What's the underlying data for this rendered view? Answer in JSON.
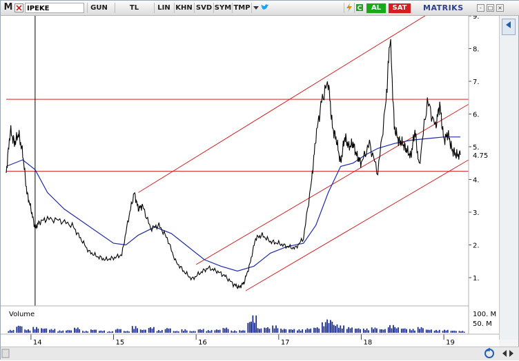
{
  "toolbar": {
    "logo": "M",
    "symbol": "IPEKE",
    "buttons": [
      "GUN",
      "TL",
      "LIN",
      "KHN",
      "SVD",
      "SYM",
      "TMP"
    ],
    "al_label": "AL",
    "sat_label": "SAT",
    "brand": "MATRIKS",
    "window_buttons": [
      "-",
      "□",
      "×"
    ]
  },
  "volume_panel": {
    "label": "Volume",
    "axis_labels": [
      "100. M",
      "50. M"
    ]
  },
  "colors": {
    "price_line": "#000000",
    "moving_average": "#1c2ba8",
    "channel_lines": "#d42020",
    "volume_bars": "#1c2f8e",
    "current_value_marker": "#000000"
  },
  "chart_data": {
    "type": "line",
    "symbol": "IPEKE",
    "current_value": "4.75",
    "y_ticks": [
      "9.",
      "8.",
      "7.",
      "6.",
      "5.",
      "4.",
      "3.",
      "2.",
      "1."
    ],
    "y_range": [
      0.2,
      9.0
    ],
    "x_ticks": [
      "14",
      "15",
      "16",
      "17",
      "18",
      "19"
    ],
    "x_range": [
      13.7,
      19.3
    ],
    "vertical_marker_x": 14.05,
    "horizontal_levels": [
      6.45,
      4.25
    ],
    "channel_lines": [
      {
        "x": [
          15.3,
          18.9
        ],
        "y": [
          3.6,
          9.2
        ]
      },
      {
        "x": [
          16.0,
          19.3
        ],
        "y": [
          1.4,
          6.3
        ]
      },
      {
        "x": [
          16.6,
          19.3
        ],
        "y": [
          0.6,
          4.6
        ]
      }
    ],
    "price_series": {
      "x": [
        13.7,
        13.75,
        13.8,
        13.85,
        13.9,
        13.95,
        14.0,
        14.05,
        14.1,
        14.2,
        14.35,
        14.5,
        14.6,
        14.7,
        14.8,
        14.9,
        15.0,
        15.1,
        15.18,
        15.25,
        15.3,
        15.35,
        15.45,
        15.55,
        15.65,
        15.75,
        15.85,
        15.95,
        16.05,
        16.15,
        16.25,
        16.35,
        16.45,
        16.52,
        16.58,
        16.65,
        16.72,
        16.8,
        16.9,
        17.0,
        17.1,
        17.2,
        17.3,
        17.4,
        17.45,
        17.52,
        17.6,
        17.65,
        17.7,
        17.75,
        17.8,
        17.85,
        17.9,
        17.95,
        18.0,
        18.1,
        18.2,
        18.3,
        18.35,
        18.4,
        18.45,
        18.5,
        18.55,
        18.6,
        18.65,
        18.7,
        18.8,
        18.9,
        18.95,
        19.0,
        19.05,
        19.1,
        19.15,
        19.2
      ],
      "y": [
        4.2,
        5.5,
        5.1,
        5.4,
        4.8,
        3.6,
        3.1,
        2.5,
        2.7,
        2.8,
        2.75,
        2.6,
        2.2,
        1.8,
        1.65,
        1.55,
        1.6,
        1.7,
        2.8,
        3.6,
        3.1,
        3.2,
        2.5,
        2.6,
        2.2,
        1.5,
        1.2,
        0.95,
        1.15,
        1.3,
        1.2,
        1.05,
        0.8,
        0.7,
        0.85,
        1.4,
        2.2,
        2.3,
        2.1,
        2.05,
        1.95,
        1.9,
        2.2,
        4.0,
        5.3,
        6.4,
        7.0,
        5.6,
        5.2,
        4.5,
        5.3,
        5.0,
        5.1,
        4.7,
        4.5,
        5.1,
        4.2,
        6.4,
        8.4,
        5.6,
        5.2,
        5.1,
        4.9,
        4.7,
        5.5,
        4.4,
        6.4,
        5.6,
        6.3,
        5.2,
        5.4,
        4.9,
        4.75,
        4.75
      ]
    },
    "moving_average": {
      "x": [
        13.7,
        13.9,
        14.05,
        14.2,
        14.4,
        14.6,
        14.8,
        15.0,
        15.15,
        15.3,
        15.5,
        15.7,
        15.9,
        16.1,
        16.3,
        16.5,
        16.7,
        16.9,
        17.1,
        17.3,
        17.45,
        17.6,
        17.75,
        17.9,
        18.05,
        18.2,
        18.4,
        18.6,
        18.8,
        19.0,
        19.2
      ],
      "y": [
        4.4,
        4.6,
        4.3,
        3.6,
        3.1,
        2.75,
        2.4,
        2.05,
        2.0,
        2.3,
        2.55,
        2.35,
        1.95,
        1.55,
        1.35,
        1.2,
        1.35,
        1.75,
        1.95,
        2.05,
        2.6,
        3.6,
        4.4,
        4.5,
        4.75,
        4.95,
        5.1,
        5.2,
        5.25,
        5.3,
        5.3
      ]
    },
    "volume": {
      "x": [
        13.72,
        13.82,
        13.92,
        14.02,
        14.12,
        14.22,
        14.32,
        14.42,
        14.52,
        14.62,
        14.72,
        14.82,
        14.92,
        15.02,
        15.12,
        15.22,
        15.32,
        15.42,
        15.52,
        15.62,
        15.72,
        15.82,
        15.92,
        16.02,
        16.12,
        16.22,
        16.32,
        16.42,
        16.52,
        16.62,
        16.66,
        16.72,
        16.82,
        16.92,
        17.02,
        17.12,
        17.22,
        17.32,
        17.42,
        17.52,
        17.58,
        17.64,
        17.72,
        17.82,
        17.92,
        18.02,
        18.12,
        18.22,
        18.32,
        18.38,
        18.48,
        18.58,
        18.68,
        18.78,
        18.88,
        18.98,
        19.08,
        19.18
      ],
      "values": [
        15,
        40,
        18,
        30,
        25,
        20,
        12,
        15,
        28,
        10,
        18,
        12,
        8,
        22,
        10,
        35,
        18,
        30,
        14,
        26,
        10,
        18,
        10,
        20,
        14,
        18,
        28,
        12,
        14,
        60,
        90,
        25,
        30,
        38,
        22,
        20,
        18,
        24,
        30,
        55,
        70,
        45,
        38,
        30,
        25,
        22,
        28,
        20,
        40,
        30,
        25,
        20,
        30,
        18,
        15,
        16,
        12,
        10
      ],
      "ylim": [
        0,
        100
      ]
    }
  }
}
